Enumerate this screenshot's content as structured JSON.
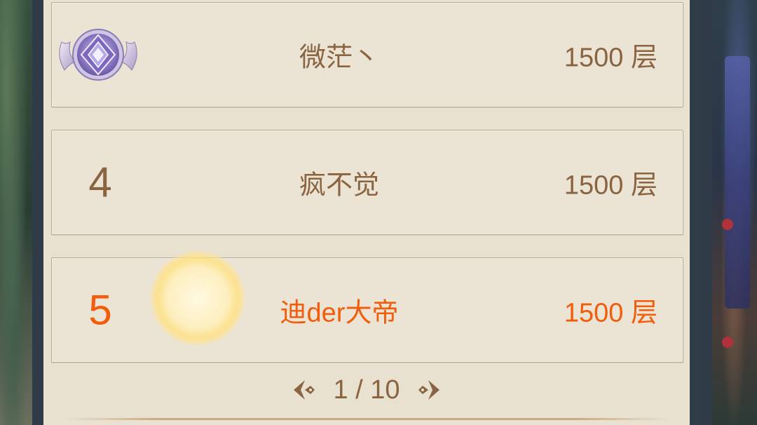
{
  "leaderboard": {
    "rows": [
      {
        "rank": "",
        "badge_icon": "diamond-rank-badge-icon",
        "name": "微茫丶",
        "score": "1500 层",
        "highlight": false
      },
      {
        "rank": "4",
        "name": "疯不觉",
        "score": "1500 层",
        "highlight": false
      },
      {
        "rank": "5",
        "name": "迪der大帝",
        "score": "1500 层",
        "highlight": true
      }
    ]
  },
  "pagination": {
    "label": "1 / 10",
    "prev_icon": "prev-page-arrow-icon",
    "next_icon": "next-page-arrow-icon"
  },
  "colors": {
    "text_normal": "#8a6440",
    "text_highlight": "#f25c0a",
    "panel_bg": "#e9e1d0"
  }
}
